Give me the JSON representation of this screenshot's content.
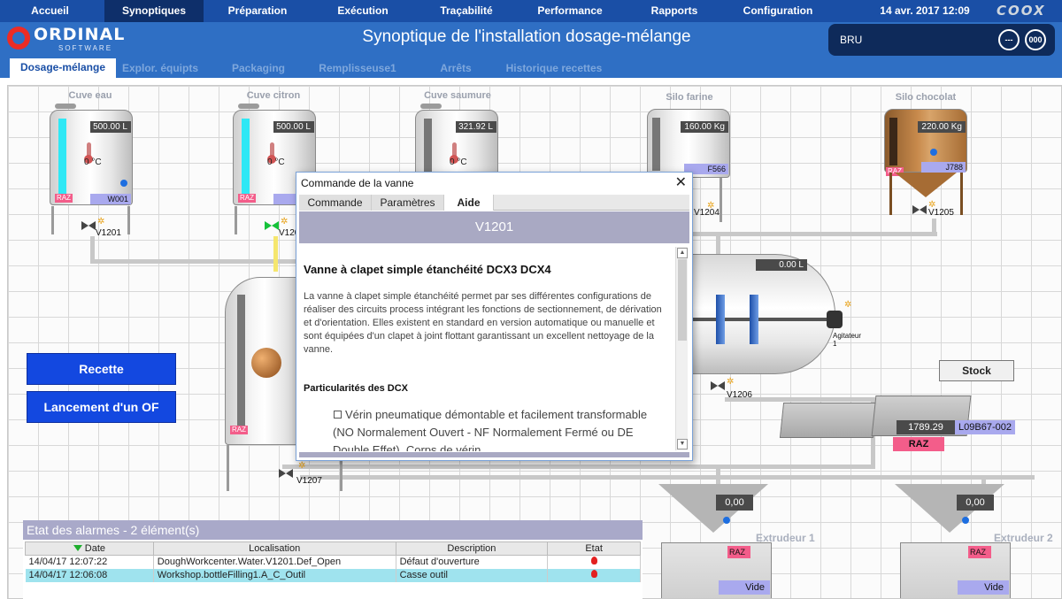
{
  "nav": {
    "items": [
      {
        "label": "Accueil",
        "active": false
      },
      {
        "label": "Synoptiques",
        "active": true
      },
      {
        "label": "Préparation",
        "active": false
      },
      {
        "label": "Exécution",
        "active": false
      },
      {
        "label": "Traçabilité",
        "active": false
      },
      {
        "label": "Performance",
        "active": false
      },
      {
        "label": "Rapports",
        "active": false
      },
      {
        "label": "Configuration",
        "active": false
      }
    ],
    "datetime": "14 avr. 2017 12:09",
    "brand": "COOX"
  },
  "header": {
    "logo_name": "ORDINAL",
    "logo_sub": "SOFTWARE",
    "title": "Synoptique de l'installation dosage-mélange",
    "user": "BRU",
    "btn_more": "---",
    "btn_zero": "000"
  },
  "subtabs": [
    {
      "label": "Dosage-mélange",
      "active": true
    },
    {
      "label": "Explor. équipts",
      "active": false
    },
    {
      "label": "Packaging",
      "active": false
    },
    {
      "label": "Remplisseuse1",
      "active": false
    },
    {
      "label": "Arrêts",
      "active": false
    },
    {
      "label": "Historique recettes",
      "active": false
    }
  ],
  "tanks": [
    {
      "label": "Cuve eau",
      "volume": "500.00 L",
      "temp": "0 °C",
      "raz": "RAZ",
      "id": "W001",
      "valve": "V1201"
    },
    {
      "label": "Cuve citron",
      "volume": "500.00 L",
      "temp": "0 °C",
      "raz": "RAZ",
      "id": "L",
      "valve": "V120"
    },
    {
      "label": "Cuve saumure",
      "volume": "321.92 L",
      "temp": "0 °C"
    },
    {
      "label": "Silo farine",
      "volume": "160.00 Kg",
      "id": "F566",
      "valve": "V1204"
    },
    {
      "label": "Silo chocolat",
      "volume": "220.00 Kg",
      "raz": "RAZ",
      "id": "J788",
      "valve": "V1205"
    }
  ],
  "mixer": {
    "volume": "0.00 L",
    "agitator": "Agitateur 1",
    "valve": "V1206"
  },
  "reactor": {
    "raz": "RAZ",
    "valve": "V1207"
  },
  "buttons": {
    "recette": "Recette",
    "lancement": "Lancement d'un OF",
    "stock": "Stock"
  },
  "stock": {
    "value": "1789.29",
    "lot": "L09B67-002",
    "raz": "RAZ"
  },
  "extruders": [
    {
      "label": "Extrudeur 1",
      "value": "0,00",
      "raz": "RAZ",
      "status": "Vide"
    },
    {
      "label": "Extrudeur 2",
      "value": "0,00",
      "raz": "RAZ",
      "status": "Vide"
    }
  ],
  "alarms": {
    "title": "Etat des alarmes - 2 élément(s)",
    "columns": [
      "Date",
      "Localisation",
      "Description",
      "Etat"
    ],
    "rows": [
      {
        "date": "14/04/17 12:07:22",
        "location": "DoughWorkcenter.Water.V1201.Def_Open",
        "description": "Défaut d'ouverture",
        "state": "alarm"
      },
      {
        "date": "14/04/17 12:06:08",
        "location": "Workshop.bottleFilling1.A_C_Outil",
        "description": "Casse outil",
        "state": "alarm"
      }
    ]
  },
  "dialog": {
    "title": "Commande de la vanne",
    "tabs": [
      {
        "label": "Commande",
        "active": false
      },
      {
        "label": "Paramètres",
        "active": false
      },
      {
        "label": "Aide",
        "active": true
      }
    ],
    "valve_id": "V1201",
    "heading": "Vanne à clapet simple étanchéité DCX3 DCX4",
    "paragraph": "La vanne à clapet simple étanchéité permet par ses différentes configurations de réaliser des circuits process intégrant les fonctions de sectionnement, de dérivation et d'orientation. Elles existent en standard en version automatique ou manuelle et sont équipées d'un clapet à joint flottant garantissant un excellent nettoyage de la vanne.",
    "subheading": "Particularités des DCX",
    "bullet": "Vérin pneumatique démontable et facilement transformable (NO Normalement Ouvert - NF Normalement Fermé ou DE Double Effet). Corps de vérin"
  },
  "colors": {
    "nav": "#1a4fa6",
    "header": "#2f6fc4",
    "accent_blue": "#1348e0",
    "raz": "#f35d8a",
    "id_tag": "#a9a9ee",
    "level_water": "#2fe8f5"
  }
}
